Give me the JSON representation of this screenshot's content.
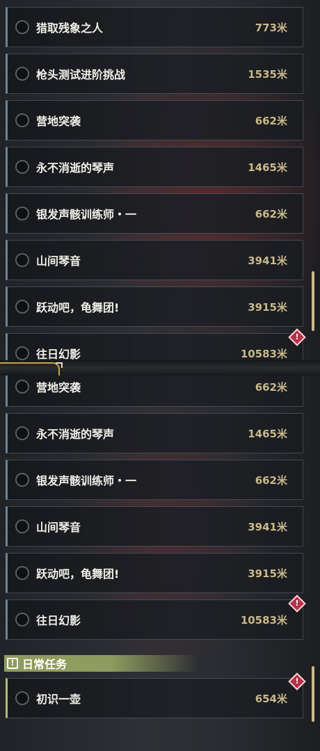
{
  "top_list": [
    {
      "name": "猎取残象之人",
      "distance": "773米"
    },
    {
      "name": "枪头测试进阶挑战",
      "distance": "1535米"
    },
    {
      "name": "营地突袭",
      "distance": "662米"
    },
    {
      "name": "永不消逝的琴声",
      "distance": "1465米"
    },
    {
      "name": "银发声骸训练师・一",
      "distance": "662米"
    },
    {
      "name": "山间琴音",
      "distance": "3941米"
    },
    {
      "name": "跃动吧，龟舞团!",
      "distance": "3915米"
    },
    {
      "name": "往日幻影",
      "distance": "10583米"
    }
  ],
  "bottom_list": [
    {
      "name": "营地突袭",
      "distance": "662米"
    },
    {
      "name": "永不消逝的琴声",
      "distance": "1465米"
    },
    {
      "name": "银发声骸训练师・一",
      "distance": "662米"
    },
    {
      "name": "山间琴音",
      "distance": "3941米"
    },
    {
      "name": "跃动吧，龟舞团!",
      "distance": "3915米"
    },
    {
      "name": "往日幻影",
      "distance": "10583米"
    }
  ],
  "daily_section": {
    "icon": "exclamation-icon",
    "title": "日常任务",
    "color": "#8f9b5f",
    "items": [
      {
        "name": "初识一壶",
        "distance": "654米"
      }
    ]
  },
  "colors": {
    "distance": "#c8b98a",
    "warning": "#b8314a",
    "row_border": "#6f8293",
    "scrollbar": "#c7b989"
  }
}
